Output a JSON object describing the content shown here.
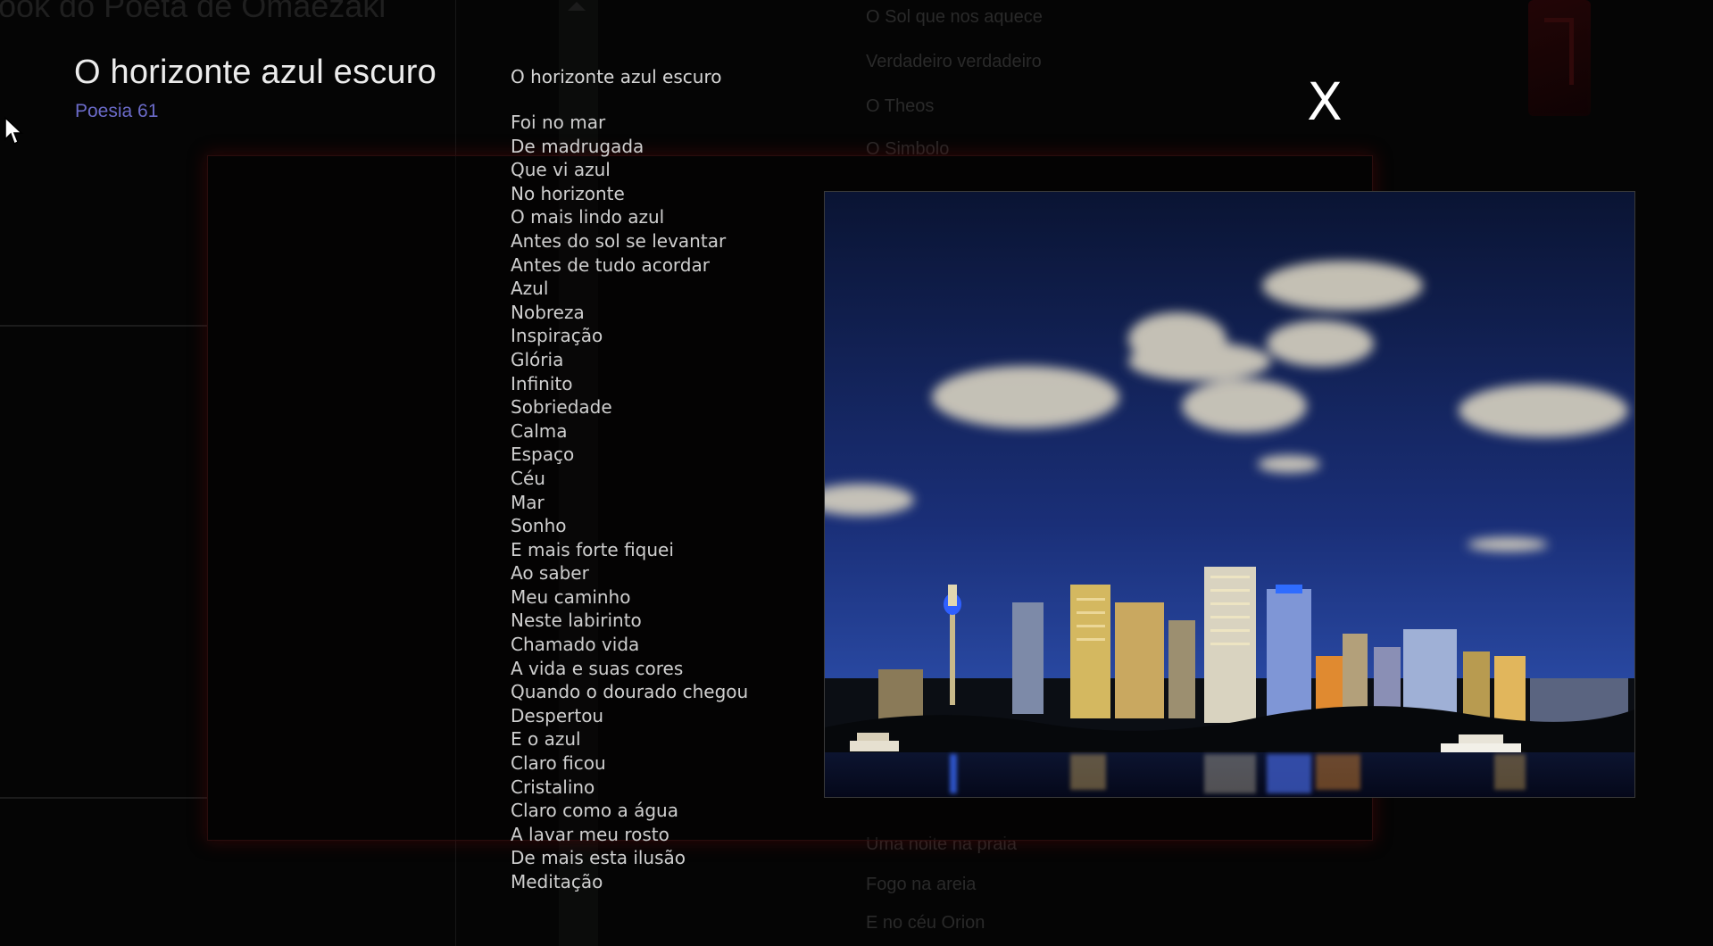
{
  "background": {
    "app_title": "ook do Poeta de Omaezaki",
    "list_items_top": [
      "O Sol que nos aquece",
      "Verdadeiro  verdadeiro",
      "O Theos",
      "O Simbolo"
    ],
    "list_items_bottom": [
      "Uma noite na praia",
      "Fogo na areia",
      "E no céu Orion"
    ]
  },
  "poem": {
    "title": "O horizonte azul escuro",
    "subtitle": "Poesia 61",
    "heading": "O horizonte azul escuro",
    "lines": [
      "Foi no mar",
      "De madrugada",
      "Que vi azul",
      "No horizonte",
      "O mais lindo azul",
      "Antes do sol se levantar",
      "Antes de tudo acordar",
      "Azul",
      "Nobreza",
      "Inspiração",
      "Glória",
      "Infinito",
      "Sobriedade",
      "Calma",
      "Espaço",
      "Céu",
      "Mar",
      "Sonho",
      "E mais forte fiquei",
      "Ao saber",
      "Meu caminho",
      "Neste labirinto",
      "Chamado vida",
      "A vida e suas cores",
      "Quando o dourado chegou",
      "Despertou",
      "E o azul",
      "Claro ficou",
      "Cristalino",
      "Claro como a água",
      "A lavar meu rosto",
      "De mais esta ilusão",
      "Meditação"
    ]
  },
  "controls": {
    "close_label": "X"
  },
  "icons": {
    "cursor": "mouse-pointer-icon",
    "close": "close-icon",
    "scroll_up": "scroll-up-arrow-icon"
  },
  "colors": {
    "title": "#ececec",
    "subtitle": "#6b6bc9",
    "poem_text": "#cfcfcf",
    "panel_glow": "#5a0808",
    "sky_top": "#0a1433",
    "sky_bottom": "#2b4ca8"
  }
}
